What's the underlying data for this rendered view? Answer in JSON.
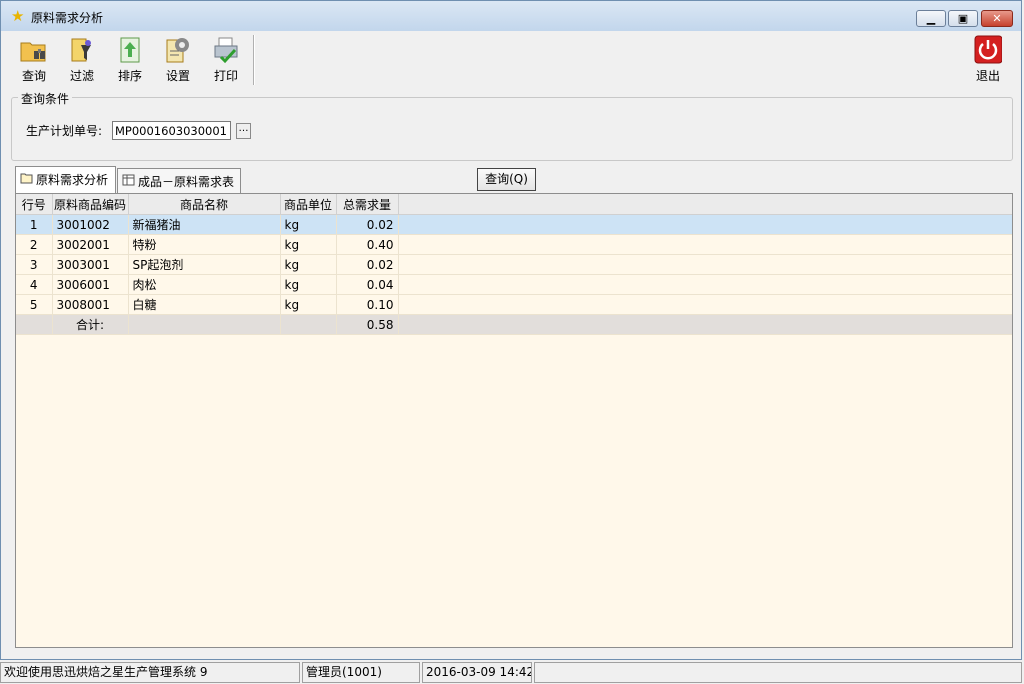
{
  "window": {
    "title": "原料需求分析"
  },
  "toolbar": {
    "query": "查询",
    "filter": "过滤",
    "sort": "排序",
    "settings": "设置",
    "print": "打印",
    "exit": "退出"
  },
  "criteria": {
    "group_title": "查询条件",
    "plan_label": "生产计划单号:",
    "plan_value": "MP0001603030001"
  },
  "tabs": [
    {
      "label": "原料需求分析",
      "active": true
    },
    {
      "label": "成品－原料需求表",
      "active": false
    }
  ],
  "query_button": "查询(Q)",
  "table": {
    "columns": [
      "行号",
      "原料商品编码",
      "商品名称",
      "商品单位",
      "总需求量"
    ],
    "rows": [
      {
        "no": "1",
        "code": "3001002",
        "name": "新福猪油",
        "unit": "kg",
        "qty": "0.02"
      },
      {
        "no": "2",
        "code": "3002001",
        "name": "特粉",
        "unit": "kg",
        "qty": "0.40"
      },
      {
        "no": "3",
        "code": "3003001",
        "name": "SP起泡剂",
        "unit": "kg",
        "qty": "0.02"
      },
      {
        "no": "4",
        "code": "3006001",
        "name": "肉松",
        "unit": "kg",
        "qty": "0.04"
      },
      {
        "no": "5",
        "code": "3008001",
        "name": "白糖",
        "unit": "kg",
        "qty": "0.10"
      }
    ],
    "total_label": "合计:",
    "total_value": "0.58"
  },
  "status": {
    "welcome": "欢迎使用思迅烘焙之星生产管理系统 9",
    "user": "管理员(1001)",
    "datetime": "2016-03-09 14:42"
  },
  "colors": {
    "grid_bg": "#fff8ea",
    "selected_row": "#cde3f5",
    "exit_red": "#d42020"
  }
}
